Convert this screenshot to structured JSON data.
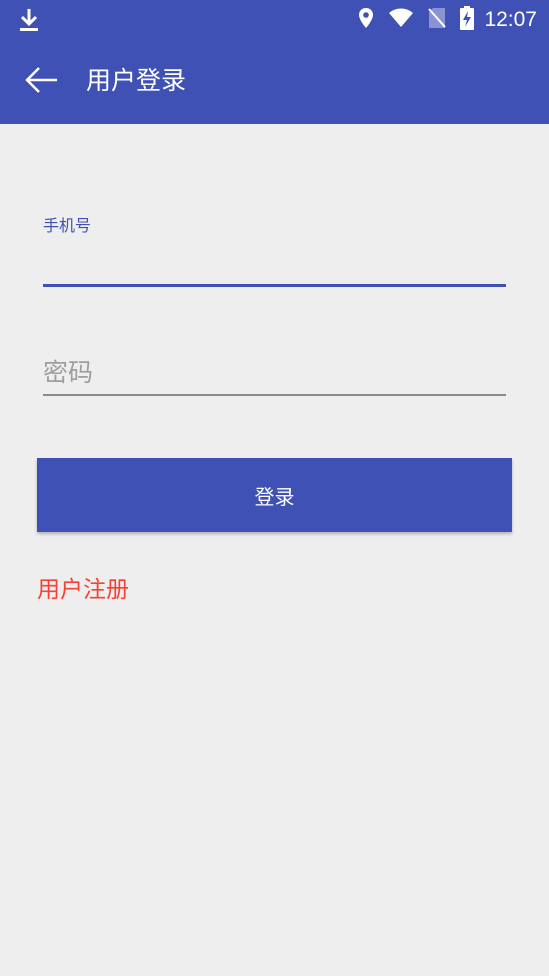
{
  "status_bar": {
    "time": "12:07",
    "icons": [
      "download-icon",
      "location-icon",
      "wifi-icon",
      "no-sim-icon",
      "battery-charging-icon"
    ]
  },
  "app_bar": {
    "title": "用户登录",
    "back_icon": "arrow-left-icon"
  },
  "form": {
    "phone": {
      "label": "手机号",
      "value": ""
    },
    "password": {
      "placeholder": "密码",
      "value": ""
    },
    "login_label": "登录",
    "register_label": "用户注册"
  },
  "colors": {
    "primary": "#3f51b5",
    "background": "#eeeeee",
    "accent_red": "#f44336",
    "underline_inactive": "#8a8a8a",
    "placeholder": "#9e9e9e"
  }
}
